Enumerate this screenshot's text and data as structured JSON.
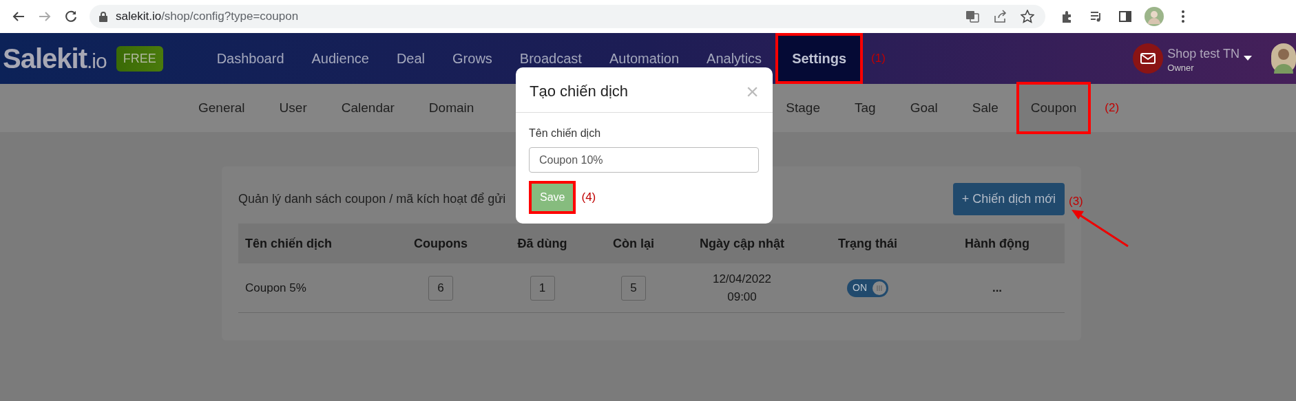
{
  "browser": {
    "url_host": "salekit.io",
    "url_path": "/shop/config?type=coupon"
  },
  "header": {
    "logo": "Salekit",
    "logo_suffix": ".io",
    "plan_badge": "FREE",
    "nav": [
      {
        "label": "Dashboard",
        "selected": false
      },
      {
        "label": "Audience",
        "selected": false
      },
      {
        "label": "Deal",
        "selected": false
      },
      {
        "label": "Grows",
        "selected": false
      },
      {
        "label": "Broadcast",
        "selected": false
      },
      {
        "label": "Automation",
        "selected": false
      },
      {
        "label": "Analytics",
        "selected": false
      },
      {
        "label": "Settings",
        "selected": true
      }
    ],
    "account": {
      "name": "Shop test TN",
      "role": "Owner"
    }
  },
  "settings_tabs": [
    {
      "label": "General",
      "selected": false
    },
    {
      "label": "User",
      "selected": false
    },
    {
      "label": "Calendar",
      "selected": false
    },
    {
      "label": "Domain",
      "selected": false
    },
    {
      "label": "Stage",
      "selected": false
    },
    {
      "label": "Tag",
      "selected": false
    },
    {
      "label": "Goal",
      "selected": false
    },
    {
      "label": "Sale",
      "selected": false
    },
    {
      "label": "Coupon",
      "selected": true
    }
  ],
  "coupons": {
    "description": "Quản lý danh sách coupon / mã kích hoạt để gửi",
    "new_button": "+ Chiến dịch mới",
    "columns": [
      "Tên chiến dịch",
      "Coupons",
      "Đã dùng",
      "Còn lại",
      "Ngày cập nhật",
      "Trạng thái",
      "Hành động"
    ],
    "rows": [
      {
        "name": "Coupon 5%",
        "coupons": "6",
        "used": "1",
        "remaining": "5",
        "updated_date": "12/04/2022",
        "updated_time": "09:00",
        "status_label": "ON",
        "on": true,
        "actions": "..."
      }
    ]
  },
  "dialog": {
    "title": "Tạo chiến dịch",
    "close": "×",
    "field_label": "Tên chiến dịch",
    "field_value": "Coupon 10%",
    "save": "Save"
  },
  "annotations": [
    "(1)",
    "(2)",
    "(3)",
    "(4)"
  ]
}
